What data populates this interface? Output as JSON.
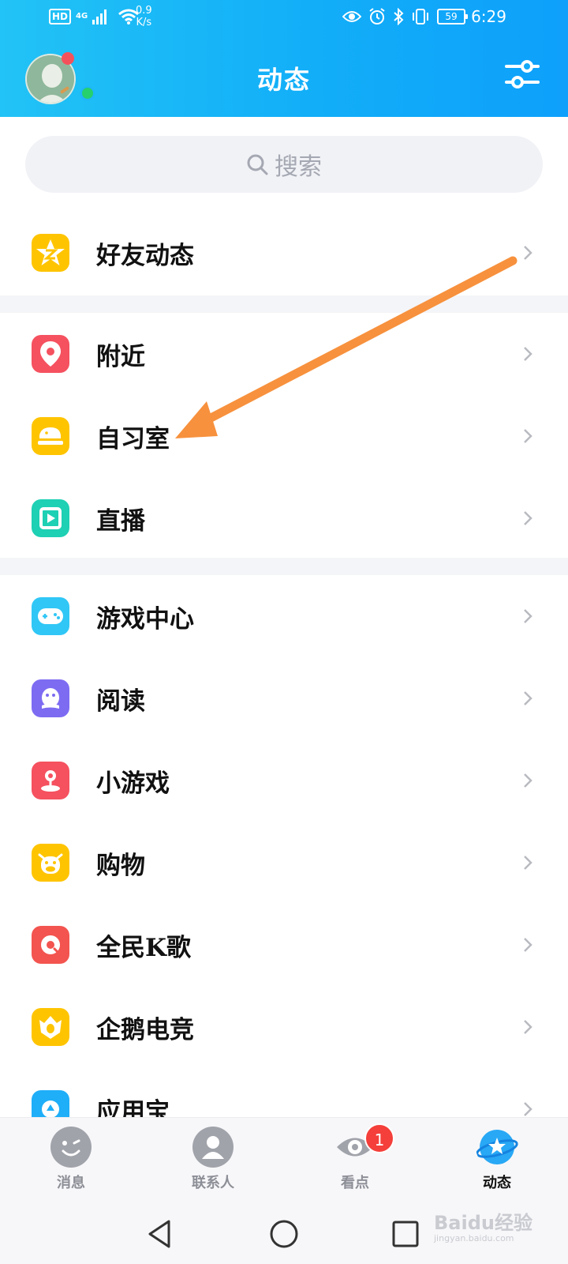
{
  "status_bar": {
    "hd": "HD",
    "network": "4G",
    "speed_value": "0.9",
    "speed_unit": "K/s",
    "battery": "59",
    "time": "6:29"
  },
  "header": {
    "title": "动态"
  },
  "search": {
    "placeholder": "搜索"
  },
  "menu": {
    "items": [
      {
        "label": "好友动态",
        "icon": "star-z-icon",
        "color": "#ffc400"
      },
      {
        "label": "附近",
        "icon": "location-pin-icon",
        "color": "#f5515f"
      },
      {
        "label": "自习室",
        "icon": "study-room-icon",
        "color": "#ffc400"
      },
      {
        "label": "直播",
        "icon": "live-play-icon",
        "color": "#1ed0b4"
      },
      {
        "label": "游戏中心",
        "icon": "gamepad-icon",
        "color": "#30c7f6"
      },
      {
        "label": "阅读",
        "icon": "reading-penguin-icon",
        "color": "#7d6cf2"
      },
      {
        "label": "小游戏",
        "icon": "joystick-icon",
        "color": "#f5515f"
      },
      {
        "label": "购物",
        "icon": "cow-face-icon",
        "color": "#ffc400"
      },
      {
        "label": "全民K歌",
        "icon": "karaoke-icon",
        "color": "#f3544f"
      },
      {
        "label": "企鹅电竞",
        "icon": "esports-crest-icon",
        "color": "#ffc400"
      },
      {
        "label": "应用宝",
        "icon": "app-store-icon",
        "color": "#1faef8"
      }
    ]
  },
  "bottom_nav": {
    "tabs": [
      {
        "label": "消息",
        "icon": "message-face-icon"
      },
      {
        "label": "联系人",
        "icon": "contacts-icon"
      },
      {
        "label": "看点",
        "icon": "eye-icon",
        "badge": "1"
      },
      {
        "label": "动态",
        "icon": "planet-icon",
        "active": true
      }
    ]
  },
  "watermark": {
    "text": "Baidu经验",
    "url": "jingyan.baidu.com"
  },
  "colors": {
    "header_start": "#22c3f6",
    "header_end": "#0ea0fb",
    "arrow": "#f7913d",
    "badge": "#f43f3a"
  }
}
